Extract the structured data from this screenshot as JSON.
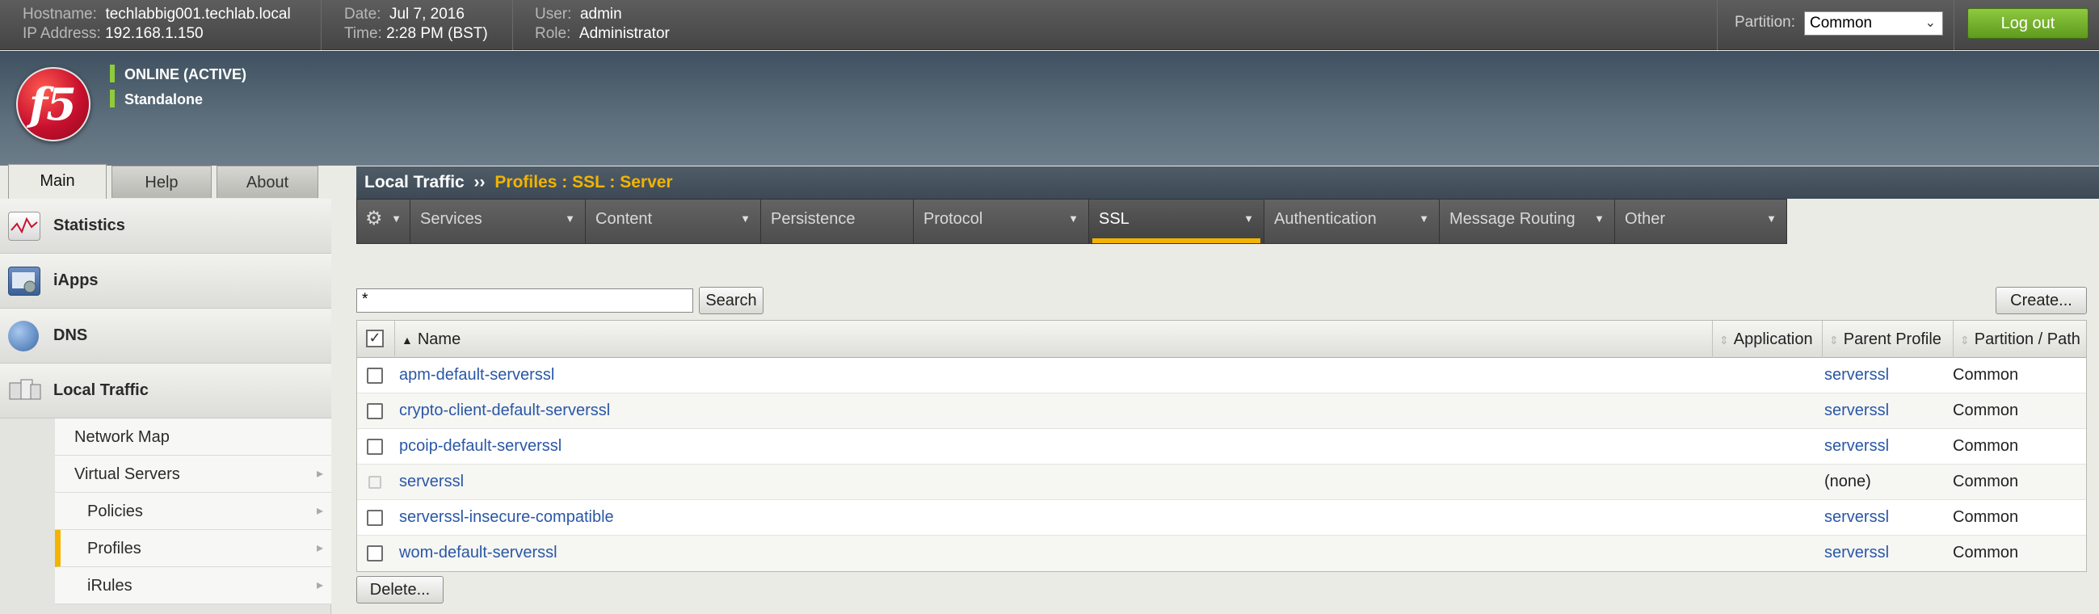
{
  "topbar": {
    "hostname_label": "Hostname:",
    "hostname": "techlabbig001.techlab.local",
    "ip_label": "IP Address:",
    "ip": "192.168.1.150",
    "date_label": "Date:",
    "date": "Jul 7, 2016",
    "time_label": "Time:",
    "time": "2:28 PM (BST)",
    "user_label": "User:",
    "user": "admin",
    "role_label": "Role:",
    "role": "Administrator",
    "partition_label": "Partition:",
    "partition_value": "Common",
    "logout_label": "Log out"
  },
  "banner": {
    "logo_text": "f5",
    "status_1": "ONLINE (ACTIVE)",
    "status_2": "Standalone",
    "status_color": "#8fcb3b"
  },
  "tabs": [
    {
      "label": "Main",
      "active": true
    },
    {
      "label": "Help",
      "active": false
    },
    {
      "label": "About",
      "active": false
    }
  ],
  "sidebar": {
    "sections": [
      {
        "label": "Statistics",
        "icon": "statistics-icon"
      },
      {
        "label": "iApps",
        "icon": "iapps-icon"
      },
      {
        "label": "DNS",
        "icon": "dns-globe-icon"
      },
      {
        "label": "Local Traffic",
        "icon": "local-traffic-icon"
      }
    ],
    "subitems": [
      {
        "label": "Network Map",
        "has_arrow": false,
        "active": false
      },
      {
        "label": "Virtual Servers",
        "has_arrow": true,
        "active": false
      },
      {
        "label": "Policies",
        "has_arrow": true,
        "active": false
      },
      {
        "label": "Profiles",
        "has_arrow": true,
        "active": true
      },
      {
        "label": "iRules",
        "has_arrow": true,
        "active": false
      }
    ]
  },
  "breadcrumb": {
    "root": "Local Traffic",
    "separator": "››",
    "section": "Profiles : SSL : Server"
  },
  "menu": {
    "gear_icon": "gear-icon",
    "items": [
      {
        "label": "Services",
        "dropdown": true
      },
      {
        "label": "Content",
        "dropdown": true
      },
      {
        "label": "Persistence",
        "dropdown": false
      },
      {
        "label": "Protocol",
        "dropdown": true
      },
      {
        "label": "SSL",
        "dropdown": true,
        "active": true
      },
      {
        "label": "Authentication",
        "dropdown": true
      },
      {
        "label": "Message Routing",
        "dropdown": true
      },
      {
        "label": "Other",
        "dropdown": true
      }
    ]
  },
  "search": {
    "value": "*",
    "button_label": "Search",
    "create_label": "Create..."
  },
  "table": {
    "columns": [
      "Name",
      "Application",
      "Parent Profile",
      "Partition / Path"
    ],
    "rows": [
      {
        "name": "apm-default-serverssl",
        "application": "",
        "parent": "serverssl",
        "partition": "Common",
        "parent_link": true,
        "selectable": true
      },
      {
        "name": "crypto-client-default-serverssl",
        "application": "",
        "parent": "serverssl",
        "partition": "Common",
        "parent_link": true,
        "selectable": true
      },
      {
        "name": "pcoip-default-serverssl",
        "application": "",
        "parent": "serverssl",
        "partition": "Common",
        "parent_link": true,
        "selectable": true
      },
      {
        "name": "serverssl",
        "application": "",
        "parent": "(none)",
        "partition": "Common",
        "parent_link": false,
        "selectable": false
      },
      {
        "name": "serverssl-insecure-compatible",
        "application": "",
        "parent": "serverssl",
        "partition": "Common",
        "parent_link": true,
        "selectable": true
      },
      {
        "name": "wom-default-serverssl",
        "application": "",
        "parent": "serverssl",
        "partition": "Common",
        "parent_link": true,
        "selectable": true
      }
    ],
    "delete_label": "Delete..."
  },
  "colors": {
    "accent": "#f2b400",
    "link": "#2a57a6",
    "logout": "#6fae2a"
  }
}
